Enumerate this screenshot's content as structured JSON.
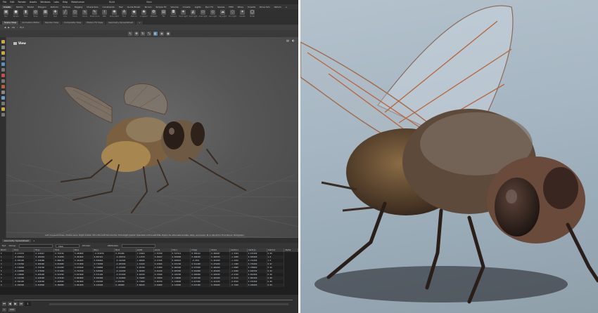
{
  "app": {
    "menu": [
      "File",
      "Edit",
      "Render",
      "Assets",
      "Windows",
      "Labs",
      "Help",
      "Metahuman"
    ],
    "build_field": "Build",
    "main_field": "Main",
    "shelf_tabs": [
      "Create",
      "Modify",
      "Model",
      "Polygon",
      "Deform",
      "Texture",
      "Rigging",
      "Characters",
      "Constraints",
      "Hair",
      "Guide Brush",
      "Terrain",
      "Simple FX",
      "Volume",
      "Crowds",
      "Lights",
      "Pyro FX",
      "Sparse",
      "FEM",
      "Wires",
      "Crowds",
      "Drive Sim",
      "Vellum",
      "+"
    ],
    "shelf_tools": [
      {
        "label": "Box",
        "icon": "box-icon"
      },
      {
        "label": "Sphere",
        "icon": "sphere-icon"
      },
      {
        "label": "Tube",
        "icon": "tube-icon"
      },
      {
        "label": "Torus",
        "icon": "torus-icon"
      },
      {
        "label": "Grid",
        "icon": "grid-icon"
      },
      {
        "label": "Null",
        "icon": "null-icon"
      },
      {
        "label": "Line",
        "icon": "line-icon"
      },
      {
        "label": "Circle",
        "icon": "circle-icon"
      },
      {
        "label": "Curve",
        "icon": "curve-icon"
      },
      {
        "label": "Draw Curve",
        "icon": "pen-icon"
      },
      {
        "label": "Path",
        "icon": "path-icon"
      },
      {
        "label": "Spray Paint",
        "icon": "spray-icon"
      },
      {
        "label": "Font",
        "icon": "font-icon"
      },
      {
        "label": "Platonic",
        "icon": "platonic-icon"
      },
      {
        "label": "L-System",
        "icon": "tree-icon"
      },
      {
        "label": "Metaball",
        "icon": "metaball-icon"
      },
      {
        "label": "File",
        "icon": "file-icon"
      },
      {
        "label": "Camera",
        "icon": "camera-icon"
      },
      {
        "label": "Point Light",
        "icon": "light-icon"
      },
      {
        "label": "Spot Light",
        "icon": "spotlight-icon"
      },
      {
        "label": "Area Light",
        "icon": "area-light-icon"
      },
      {
        "label": "Geo Light",
        "icon": "geo-light-icon"
      },
      {
        "label": "Sky Light",
        "icon": "sky-icon"
      },
      {
        "label": "Env Light",
        "icon": "env-icon"
      },
      {
        "label": "Caustic",
        "icon": "caustic-icon"
      },
      {
        "label": "Portal",
        "icon": "portal-icon"
      }
    ],
    "pane_tabs": [
      "Scene View",
      "Animation Editor",
      "Render View",
      "Composite View",
      "Motion FX View",
      "Geometry Spreadsheet",
      "+"
    ],
    "path": [
      "obj",
      "fly1"
    ],
    "viewport_title": "View",
    "viewport_hint": "Left mouse tumbles. Middle pans. Right dollies. Ctrl+Alt+Left box-zooms. Ctrl+Right zooms. Spacebar+Ctrl+Left tilts. Hold L for alternate tumble, dolly, and zoom.   M or Alt+M for First Person Navigation.",
    "spreadsheet": {
      "tab": "Geometry Spreadsheet",
      "node": "fly1",
      "group_label": "Group:",
      "filter_placeholder": "View",
      "intrinsic_label": "Intrinsic",
      "attributes_label": "Attributes:",
      "columns": [
        "Point",
        "P[x]",
        "P[y]",
        "P[z]",
        "N[x]",
        "N[y]",
        "N[z]",
        "uv[0]",
        "uv[1]",
        "Cd[r]",
        "Cd[g]",
        "Cd[b]",
        "rest[x]",
        "rest[y]",
        "rest[z]",
        "Alpha"
      ],
      "rows": [
        [
          "0",
          "-0.271570",
          "0.116447",
          "0.733746",
          "0.184069",
          "-0.972076",
          "0.353486",
          "1.15664",
          "1.35768",
          "0.347214",
          "0.385142",
          "0.496287",
          "-1.3104",
          "0.671500",
          "0.99"
        ],
        [
          "1",
          "-0.295614",
          "0.181604",
          "0.712950",
          "0.301022",
          "0.897221",
          "-0.299741",
          "1.11570",
          "0.28447",
          "0.090088",
          "0.468299",
          "0.498760",
          "-1.2688",
          "0.689200",
          "1.0"
        ],
        [
          "2",
          "-0.305109",
          "0.236388",
          "0.686170",
          "0.444163",
          "0.839262",
          "-0.342184",
          "1.06620",
          "0.37245",
          "0.068210",
          "-0.2591",
          "0.491050",
          "-1.2016",
          "0.724100",
          "1.0"
        ],
        [
          "3",
          "-0.313360",
          "0.289400",
          "0.653900",
          "0.571000",
          "0.770300",
          "-0.283300",
          "1.01100",
          "0.45600",
          "0.074700",
          "0.512400",
          "0.479200",
          "-1.1460",
          "0.756300",
          "0.97"
        ],
        [
          "4",
          "-0.318200",
          "0.334700",
          "0.615200",
          "0.670100",
          "0.709800",
          "-0.215400",
          "0.95700",
          "0.53900",
          "0.084500",
          "0.537600",
          "0.466200",
          "-1.0880",
          "0.788600",
          "0.95"
        ],
        [
          "5",
          "-0.319800",
          "0.373600",
          "0.571400",
          "0.752700",
          "0.643000",
          "-0.141600",
          "0.90300",
          "0.62100",
          "0.095300",
          "0.561800",
          "0.452400",
          "-1.0290",
          "0.820700",
          "0.92"
        ],
        [
          "6",
          "-0.318000",
          "0.405200",
          "0.523700",
          "0.817600",
          "0.571100",
          "-0.073300",
          "0.84700",
          "0.70300",
          "0.106700",
          "0.585000",
          "0.438700",
          "-0.9700",
          "0.852500",
          "0.90"
        ],
        [
          "7",
          "-0.312700",
          "0.429100",
          "0.473100",
          "0.863600",
          "0.503200",
          "-0.012900",
          "0.79200",
          "0.78500",
          "0.118600",
          "0.607100",
          "0.425200",
          "-0.9110",
          "0.884100",
          "0.88"
        ],
        [
          "8",
          "-0.304100",
          "0.445300",
          "0.420500",
          "0.891000",
          "0.452500",
          "0.035700",
          "0.73600",
          "0.86700",
          "0.130900",
          "0.627900",
          "0.412100",
          "-0.8520",
          "0.915300",
          "0.86"
        ],
        [
          "9",
          "-0.292500",
          "0.453800",
          "0.366900",
          "0.901200",
          "0.420100",
          "0.105900",
          "0.68100",
          "0.94900",
          "0.143600",
          "0.647400",
          "0.399400",
          "-0.7940",
          "0.946200",
          "0.84"
        ]
      ]
    },
    "timeline": {
      "frame": "1",
      "start": "1",
      "end": "240"
    }
  },
  "colors": {
    "ui_bg": "#3a3a3a",
    "viewport_center": "#6a6a6a",
    "photo_bg": "#a9b8c4",
    "fly_body": "#5a4630",
    "fly_eye": "#2a1e18",
    "wing_vein": "#b8633a"
  }
}
